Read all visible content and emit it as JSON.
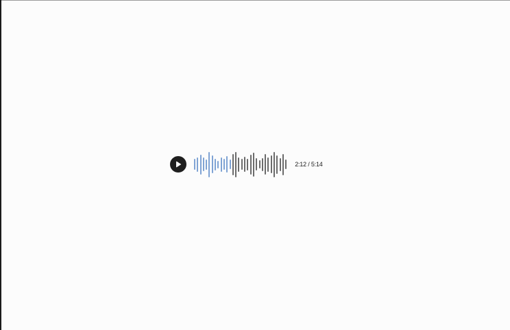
{
  "player": {
    "current_time": "2:12",
    "separator": "/",
    "total_time": "5:14",
    "played_fraction": 0.42,
    "colors": {
      "played": "#7fa3d4",
      "unplayed": "#6b6b6b",
      "button": "#1f1f1f"
    },
    "icon": "play-icon",
    "waveform_levels": [
      0.42,
      0.58,
      0.78,
      0.55,
      0.4,
      1.0,
      0.7,
      0.46,
      0.3,
      0.58,
      0.44,
      0.66,
      0.38,
      0.84,
      1.0,
      0.56,
      0.44,
      0.6,
      0.46,
      0.78,
      0.94,
      0.48,
      0.32,
      0.5,
      0.8,
      0.58,
      0.7,
      1.0,
      0.74,
      0.5,
      0.84,
      0.38
    ]
  }
}
